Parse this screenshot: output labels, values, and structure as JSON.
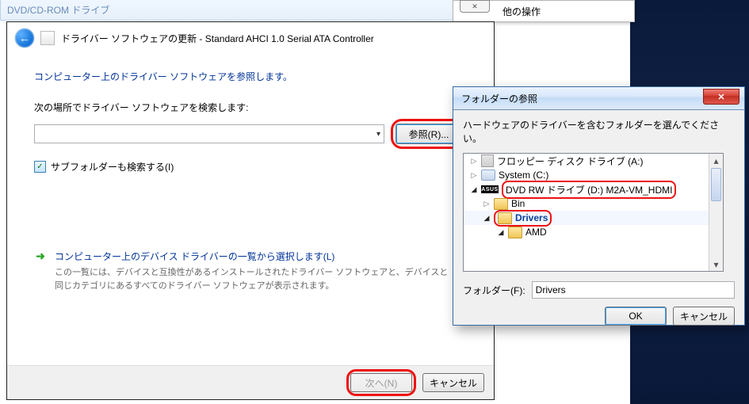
{
  "top_blur_text": "DVD/CD-ROM ドライブ",
  "context_menu": {
    "label": "他の操作",
    "close": "✕"
  },
  "wizard": {
    "title": "ドライバー ソフトウェアの更新 - Standard AHCI 1.0 Serial ATA Controller",
    "heading": "コンピューター上のドライバー ソフトウェアを参照します。",
    "search_label": "次の場所でドライバー ソフトウェアを検索します:",
    "path_value": "",
    "browse_label": "参照(R)...",
    "subfolder_label": "サブフォルダーも検索する(I)",
    "subfolder_checked": true,
    "pick_title": "コンピューター上のデバイス ドライバーの一覧から選択します(L)",
    "pick_desc": "この一覧には、デバイスと互換性があるインストールされたドライバー ソフトウェアと、デバイスと同じカテゴリにあるすべてのドライバー ソフトウェアが表示されます。",
    "next_label": "次へ(N)",
    "cancel_label": "キャンセル"
  },
  "folder_dialog": {
    "title": "フォルダーの参照",
    "instruction": "ハードウェアのドライバーを含むフォルダーを選んでください。",
    "tree": {
      "floppy": "フロッピー ディスク ドライブ (A:)",
      "system": "System (C:)",
      "dvd": "DVD RW ドライブ (D:) M2A-VM_HDMI",
      "bin": "Bin",
      "drivers": "Drivers",
      "amd": "AMD",
      "asus_tag": "ASUS"
    },
    "folder_label": "フォルダー(F):",
    "folder_value": "Drivers",
    "ok_label": "OK",
    "cancel_label": "キャンセル"
  }
}
